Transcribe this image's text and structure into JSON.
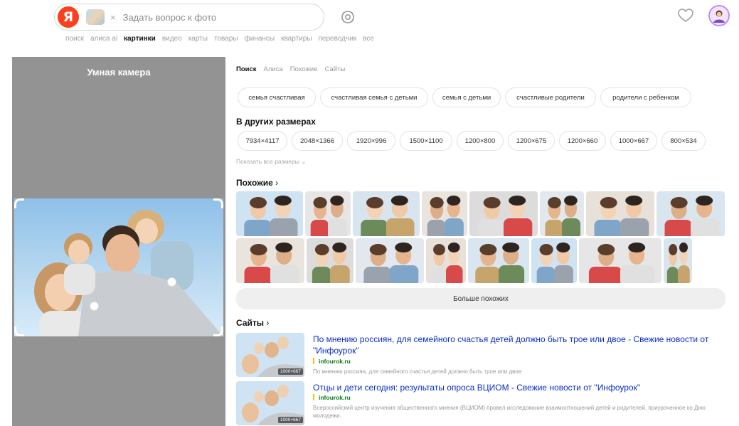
{
  "header": {
    "logo_letter": "Я",
    "chip_close": "×",
    "search_placeholder": "Задать вопрос к фото",
    "tabs": [
      "поиск",
      "алиса ai",
      "картинки",
      "видео",
      "карты",
      "товары",
      "финансы",
      "квартиры",
      "переводчик",
      "все"
    ],
    "active_tab": "картинки",
    "icons": [
      "camera-lens-icon",
      "heart-icon",
      "avatar-icon"
    ]
  },
  "left_panel": {
    "title": "Умная камера"
  },
  "results": {
    "tabs": [
      "Поиск",
      "Алиса",
      "Похожие",
      "Сайты"
    ],
    "active_tab": "Поиск",
    "suggestions": [
      "семья счастливая",
      "счастливая семья с детьми",
      "семья с детьми",
      "счастливые родители",
      "родители с ребенком"
    ],
    "sizes_title": "В других размерах",
    "sizes": [
      "7934×4117",
      "2048×1366",
      "1920×996",
      "1500×1100",
      "1200×800",
      "1200×675",
      "1200×660",
      "1000×667",
      "800×534"
    ],
    "show_all_sizes": "Показать все размеры",
    "similar_title": "Похожие",
    "more_similar": "Больше похожих",
    "sites_title": "Сайты",
    "sites": [
      {
        "title": "По мнению россиян, для семейного счастья детей должно быть трое или двое - Свежие новости от \"Инфоурок\"",
        "host": "infourok.ru",
        "desc": "По мнению россиян, для семейного счастья детей должно быть трое или двое",
        "badge": "1000×667"
      },
      {
        "title": "Отцы и дети сегодня: результаты опроса ВЦИОМ - Свежие новости от \"Инфоурок\"",
        "host": "infourok.ru",
        "desc": "Всероссийский центр изучения общественного мнения (ВЦИОМ) провел исследование взаимоотношений детей и родителей, приуроченное ко Дню молодежи.",
        "badge": "1000×667"
      }
    ]
  },
  "colors": {
    "brand": "#fc3f1d",
    "link": "#0a2ec8",
    "host": "#0a7a1a",
    "panel_grey": "#939393"
  }
}
